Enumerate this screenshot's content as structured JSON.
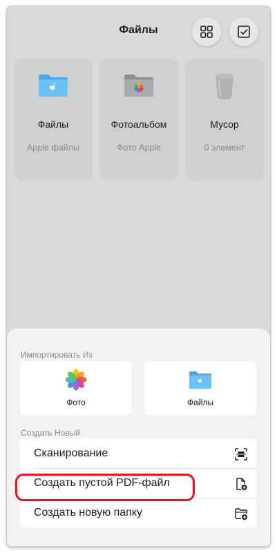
{
  "header": {
    "title": "Файлы"
  },
  "cards": [
    {
      "name": "Файлы",
      "sub": "Apple файлы",
      "icon": "folder-apple-icon"
    },
    {
      "name": "Фотоальбом",
      "sub": "Фото Apple",
      "icon": "photo-album-folder-icon"
    },
    {
      "name": "Мусор",
      "sub": "0 элемент",
      "icon": "trash-icon"
    }
  ],
  "sheet": {
    "import_label": "Импортировать Из",
    "import_tiles": [
      {
        "label": "Фото",
        "icon": "photos-app-icon"
      },
      {
        "label": "Файлы",
        "icon": "files-folder-icon"
      }
    ],
    "create_label": "Создать Новый",
    "create_items": [
      {
        "label": "Сканирование",
        "icon": "scan-icon"
      },
      {
        "label": "Создать пустой PDF-файл",
        "icon": "new-document-icon"
      },
      {
        "label": "Создать новую папку",
        "icon": "new-folder-icon"
      }
    ]
  },
  "colors": {
    "highlight": "#e8141b",
    "folder_blue": "#5ab8f2"
  }
}
